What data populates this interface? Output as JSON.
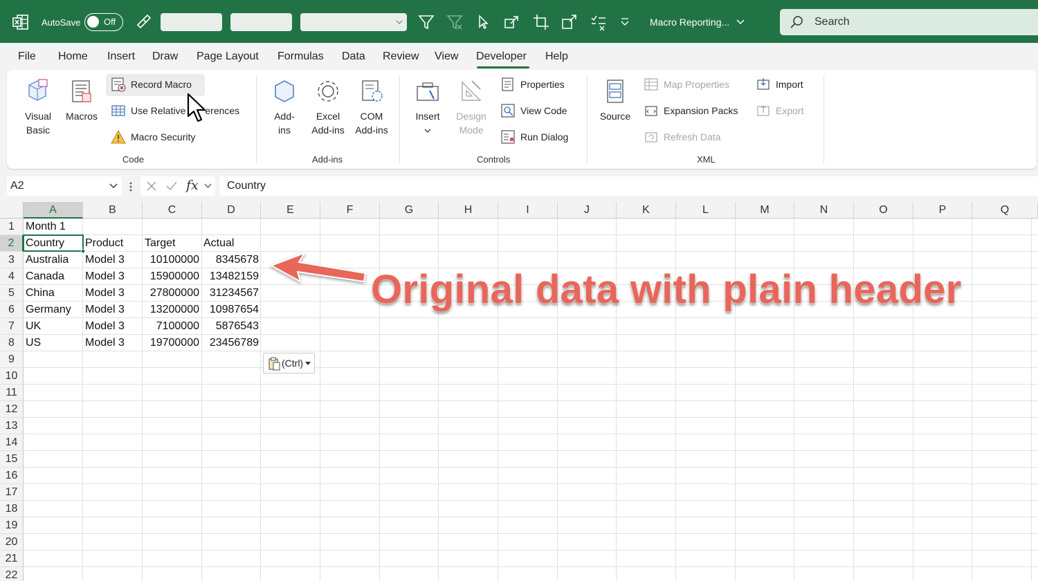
{
  "titlebar": {
    "autosave_label": "AutoSave",
    "toggle_state": "Off",
    "doc_title": "Macro Reporting...",
    "search_placeholder": "Search",
    "colors": {
      "brand": "#217346"
    }
  },
  "menu": {
    "tabs": [
      "File",
      "Home",
      "Insert",
      "Draw",
      "Page Layout",
      "Formulas",
      "Data",
      "Review",
      "View",
      "Developer",
      "Help"
    ],
    "active": "Developer"
  },
  "ribbon": {
    "code": {
      "visual_basic": [
        "Visual",
        "Basic"
      ],
      "macros": "Macros",
      "record_macro": "Record Macro",
      "use_relative": "Use Relative",
      "use_relative_tail": "erences",
      "macro_security": "Macro Security",
      "group_label": "Code"
    },
    "addins": {
      "addins": [
        "Add-",
        "ins"
      ],
      "excel_addins": [
        "Excel",
        "Add-ins"
      ],
      "com_addins": [
        "COM",
        "Add-ins"
      ],
      "group_label": "Add-ins"
    },
    "controls": {
      "insert": "Insert",
      "design_mode": [
        "Design",
        "Mode"
      ],
      "properties": "Properties",
      "view_code": "View Code",
      "run_dialog": "Run Dialog",
      "group_label": "Controls"
    },
    "xml": {
      "source": "Source",
      "map_properties": "Map Properties",
      "expansion_packs": "Expansion Packs",
      "refresh_data": "Refresh Data",
      "import": "Import",
      "export": "Export",
      "group_label": "XML"
    }
  },
  "formula_bar": {
    "name_box": "A2",
    "fx": "fx",
    "value": "Country"
  },
  "sheet": {
    "columns": [
      "A",
      "B",
      "C",
      "D",
      "E",
      "F",
      "G",
      "H",
      "I",
      "J",
      "K",
      "L",
      "M",
      "N",
      "O",
      "P",
      "Q"
    ],
    "rows": [
      "1",
      "2",
      "3",
      "4",
      "5",
      "6",
      "7",
      "8",
      "9",
      "10",
      "11",
      "12",
      "13",
      "14",
      "15",
      "16",
      "17",
      "18",
      "19",
      "20",
      "21",
      "22"
    ],
    "selected_cell": "A2",
    "cells": {
      "a1": "Month 1",
      "header": [
        "Country",
        "Product",
        "Target",
        "Actual"
      ],
      "data": [
        [
          "Australia",
          "Model 3",
          "10100000",
          "8345678"
        ],
        [
          "Canada",
          "Model 3",
          "15900000",
          "13482159"
        ],
        [
          "China",
          "Model 3",
          "27800000",
          "31234567"
        ],
        [
          "Germany",
          "Model 3",
          "13200000",
          "10987654"
        ],
        [
          "UK",
          "Model 3",
          "7100000",
          "5876543"
        ],
        [
          "US",
          "Model 3",
          "19700000",
          "23456789"
        ]
      ]
    },
    "paste_options": "(Ctrl)"
  },
  "annotation": "Original data with plain header"
}
